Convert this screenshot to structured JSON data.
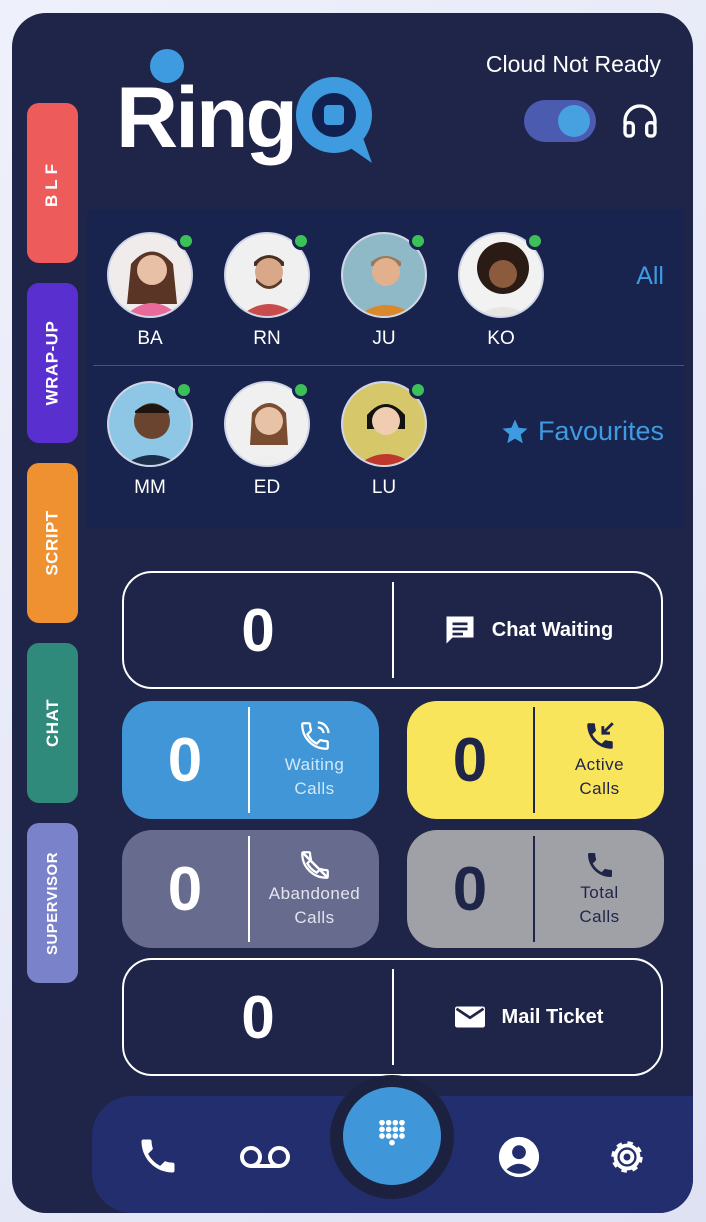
{
  "app": {
    "logo_text": "RingQ",
    "status": "Cloud Not Ready",
    "toggle_on": true
  },
  "side_tabs": [
    {
      "label": "BLF",
      "color": "#ee5b5b"
    },
    {
      "label": "WRAP-UP",
      "color": "#5a2fd0"
    },
    {
      "label": "SCRIPT",
      "color": "#ef9031"
    },
    {
      "label": "CHAT",
      "color": "#2f8a7b"
    },
    {
      "label": "SUPERVISOR",
      "color": "#7a83c9"
    }
  ],
  "contacts": {
    "all_label": "All",
    "favourites_label": "Favourites",
    "all": [
      {
        "initials": "BA",
        "online": true
      },
      {
        "initials": "RN",
        "online": true
      },
      {
        "initials": "JU",
        "online": true
      },
      {
        "initials": "KO",
        "online": true
      }
    ],
    "favourites": [
      {
        "initials": "MM",
        "online": true
      },
      {
        "initials": "ED",
        "online": true
      },
      {
        "initials": "LU",
        "online": true
      }
    ]
  },
  "stats": {
    "chat_waiting": {
      "count": "0",
      "label": "Chat Waiting"
    },
    "waiting_calls": {
      "count": "0",
      "label_line1": "Waiting",
      "label_line2": "Calls"
    },
    "active_calls": {
      "count": "0",
      "label_line1": "Active",
      "label_line2": "Calls"
    },
    "abandoned_calls": {
      "count": "0",
      "label_line1": "Abandoned",
      "label_line2": "Calls"
    },
    "total_calls": {
      "count": "0",
      "label_line1": "Total",
      "label_line2": "Calls"
    },
    "mail_ticket": {
      "count": "0",
      "label": "Mail Ticket"
    }
  },
  "bottom_nav": [
    "phone-icon",
    "voicemail-icon",
    "dialpad-icon",
    "account-icon",
    "settings-icon"
  ],
  "colors": {
    "background": "#1f2548",
    "accent": "#3f96d9",
    "online": "#3cc158",
    "active_yellow": "#f8e55c"
  }
}
